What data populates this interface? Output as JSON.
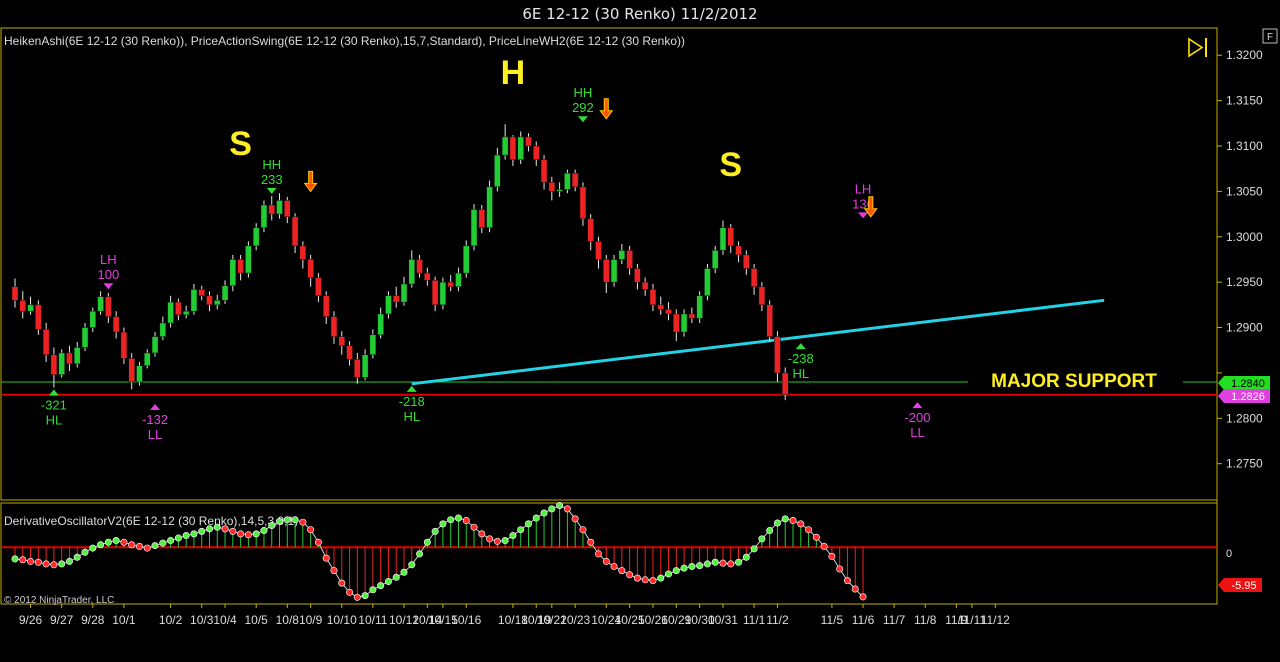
{
  "window": {
    "title": "6E 12-12 (30 Renko)  11/2/2012"
  },
  "price_panel": {
    "indicator_label": "HeikenAshi(6E 12-12 (30 Renko)), PriceActionSwing(6E 12-12 (30 Renko),15,7,Standard), PriceLineWH2(6E 12-12 (30 Renko))",
    "support_label": "MAJOR SUPPORT",
    "price_tag_green": "1.2840",
    "price_tag_magenta": "1.2826",
    "f_button": "F",
    "big_labels": [
      {
        "text": "S",
        "bar": 29
      },
      {
        "text": "H",
        "bar": 64
      },
      {
        "text": "S",
        "bar": 92
      }
    ]
  },
  "oscillator_panel": {
    "indicator_label": "DerivativeOscillatorV2(6E 12-12 (30 Renko),14,5,3,9,1)",
    "zero_label": "0",
    "value_tag": "-5.95",
    "copyright": "© 2012 NinjaTrader, LLC"
  },
  "colors": {
    "up": "#22cc33",
    "down": "#ee2222",
    "support_green": "#22cc22",
    "support_red": "#dd0000",
    "trendline": "#22d3e6",
    "label_yellow": "#ffee22",
    "swing_green": "#33dd33",
    "swing_magenta": "#e040e0",
    "axis_yellow": "#c8b400"
  },
  "chart_data": {
    "type": "candlestick",
    "title": "6E 12-12 (30 Renko)  11/2/2012",
    "ylim": [
      1.271,
      1.323
    ],
    "yticks": [
      1.32,
      1.315,
      1.31,
      1.305,
      1.3,
      1.295,
      1.29,
      1.285,
      1.28,
      1.275
    ],
    "ytick_labels": [
      "1.3200",
      "1.3150",
      "1.3100",
      "1.3050",
      "1.3000",
      "1.2950",
      "1.2900",
      "",
      "1.2800",
      "1.2750"
    ],
    "x_labels": [
      "9/26",
      "9/27",
      "9/28",
      "10/1",
      "10/2",
      "10/3",
      "10/4",
      "10/5",
      "10/8",
      "10/9",
      "10/10",
      "10/11",
      "10/12",
      "10/14",
      "10/15",
      "10/16",
      "10/18",
      "10/19",
      "10/22",
      "10/23",
      "10/24",
      "10/25",
      "10/26",
      "10/29",
      "10/30",
      "10/31",
      "11/1",
      "11/2",
      "11/5",
      "11/6",
      "11/7",
      "11/8",
      "11/9",
      "11/11",
      "11/12"
    ],
    "x_label_bars": [
      2,
      6,
      10,
      14,
      20,
      24,
      27,
      31,
      35,
      38,
      42,
      46,
      50,
      53,
      55,
      58,
      64,
      67,
      69,
      72,
      76,
      79,
      82,
      85,
      88,
      91,
      95,
      98,
      105,
      109,
      113,
      117,
      121,
      123,
      126
    ],
    "candles": [
      [
        1.2945,
        1.293,
        1.2954,
        1.2922
      ],
      [
        1.293,
        1.2918,
        1.294,
        1.291
      ],
      [
        1.2918,
        1.2925,
        1.2934,
        1.2914
      ],
      [
        1.2925,
        1.2898,
        1.293,
        1.2892
      ],
      [
        1.2898,
        1.287,
        1.2905,
        1.2862
      ],
      [
        1.287,
        1.2848,
        1.2878,
        1.2834
      ],
      [
        1.2848,
        1.2872,
        1.2876,
        1.2845
      ],
      [
        1.2872,
        1.286,
        1.288,
        1.2852
      ],
      [
        1.286,
        1.2878,
        1.2884,
        1.2856
      ],
      [
        1.2878,
        1.29,
        1.2905,
        1.2874
      ],
      [
        1.29,
        1.2918,
        1.2922,
        1.2895
      ],
      [
        1.2918,
        1.2934,
        1.294,
        1.2914
      ],
      [
        1.2934,
        1.2912,
        1.2938,
        1.2905
      ],
      [
        1.2912,
        1.2895,
        1.2918,
        1.2888
      ],
      [
        1.2895,
        1.2866,
        1.29,
        1.286
      ],
      [
        1.2866,
        1.284,
        1.2872,
        1.2832
      ],
      [
        1.284,
        1.2858,
        1.2862,
        1.2836
      ],
      [
        1.2858,
        1.2872,
        1.2876,
        1.2855
      ],
      [
        1.2872,
        1.289,
        1.2895,
        1.2868
      ],
      [
        1.289,
        1.2905,
        1.2912,
        1.2886
      ],
      [
        1.2905,
        1.2928,
        1.2935,
        1.29
      ],
      [
        1.2928,
        1.2914,
        1.2932,
        1.2908
      ],
      [
        1.2914,
        1.2918,
        1.2924,
        1.291
      ],
      [
        1.2918,
        1.2942,
        1.2948,
        1.2914
      ],
      [
        1.2942,
        1.2935,
        1.2946,
        1.293
      ],
      [
        1.2935,
        1.2925,
        1.294,
        1.2918
      ],
      [
        1.2925,
        1.293,
        1.2936,
        1.292
      ],
      [
        1.293,
        1.2946,
        1.2952,
        1.2926
      ],
      [
        1.2946,
        1.2975,
        1.298,
        1.294
      ],
      [
        1.2975,
        1.296,
        1.298,
        1.2952
      ],
      [
        1.296,
        1.299,
        1.2995,
        1.2955
      ],
      [
        1.299,
        1.301,
        1.3015,
        1.2985
      ],
      [
        1.301,
        1.3035,
        1.304,
        1.3005
      ],
      [
        1.3035,
        1.3025,
        1.3045,
        1.3018
      ],
      [
        1.3025,
        1.304,
        1.3048,
        1.302
      ],
      [
        1.304,
        1.3022,
        1.3044,
        1.3015
      ],
      [
        1.3022,
        1.299,
        1.3026,
        1.2982
      ],
      [
        1.299,
        1.2975,
        1.2995,
        1.2965
      ],
      [
        1.2975,
        1.2955,
        1.298,
        1.2945
      ],
      [
        1.2955,
        1.2935,
        1.296,
        1.2928
      ],
      [
        1.2935,
        1.2912,
        1.294,
        1.2904
      ],
      [
        1.2912,
        1.289,
        1.2918,
        1.2882
      ],
      [
        1.289,
        1.288,
        1.2896,
        1.287
      ],
      [
        1.288,
        1.2865,
        1.2885,
        1.2858
      ],
      [
        1.2865,
        1.2845,
        1.2872,
        1.2838
      ],
      [
        1.2845,
        1.287,
        1.2876,
        1.2842
      ],
      [
        1.287,
        1.2892,
        1.2898,
        1.2866
      ],
      [
        1.2892,
        1.2915,
        1.2922,
        1.2888
      ],
      [
        1.2915,
        1.2935,
        1.294,
        1.291
      ],
      [
        1.2935,
        1.2928,
        1.2945,
        1.2922
      ],
      [
        1.2928,
        1.2948,
        1.2956,
        1.2924
      ],
      [
        1.2948,
        1.2975,
        1.2985,
        1.2944
      ],
      [
        1.2975,
        1.296,
        1.298,
        1.2955
      ],
      [
        1.296,
        1.2952,
        1.2966,
        1.2946
      ],
      [
        1.2952,
        1.2925,
        1.2956,
        1.2918
      ],
      [
        1.2925,
        1.295,
        1.2955,
        1.292
      ],
      [
        1.295,
        1.2945,
        1.2958,
        1.294
      ],
      [
        1.2945,
        1.296,
        1.2966,
        1.294
      ],
      [
        1.296,
        1.299,
        1.2996,
        1.2955
      ],
      [
        1.299,
        1.303,
        1.3036,
        1.2985
      ],
      [
        1.303,
        1.301,
        1.3035,
        1.3004
      ],
      [
        1.301,
        1.3055,
        1.3062,
        1.3005
      ],
      [
        1.3055,
        1.309,
        1.3098,
        1.305
      ],
      [
        1.309,
        1.311,
        1.3124,
        1.3085
      ],
      [
        1.311,
        1.3085,
        1.3112,
        1.3078
      ],
      [
        1.3085,
        1.311,
        1.3116,
        1.308
      ],
      [
        1.311,
        1.31,
        1.3114,
        1.3094
      ],
      [
        1.31,
        1.3085,
        1.3105,
        1.3078
      ],
      [
        1.3085,
        1.306,
        1.309,
        1.3052
      ],
      [
        1.306,
        1.305,
        1.3066,
        1.304
      ],
      [
        1.305,
        1.3052,
        1.306,
        1.3044
      ],
      [
        1.3052,
        1.307,
        1.3074,
        1.3048
      ],
      [
        1.307,
        1.3055,
        1.3074,
        1.305
      ],
      [
        1.3055,
        1.302,
        1.306,
        1.3012
      ],
      [
        1.302,
        1.2995,
        1.3025,
        1.2985
      ],
      [
        1.2995,
        1.2975,
        1.3,
        1.2965
      ],
      [
        1.2975,
        1.295,
        1.298,
        1.2938
      ],
      [
        1.295,
        1.2975,
        1.298,
        1.2945
      ],
      [
        1.2975,
        1.2985,
        1.2992,
        1.297
      ],
      [
        1.2985,
        1.2965,
        1.299,
        1.2958
      ],
      [
        1.2965,
        1.295,
        1.297,
        1.2942
      ],
      [
        1.295,
        1.2942,
        1.2955,
        1.2935
      ],
      [
        1.2942,
        1.2925,
        1.2948,
        1.2918
      ],
      [
        1.2925,
        1.292,
        1.2934,
        1.2914
      ],
      [
        1.292,
        1.2915,
        1.2928,
        1.2908
      ],
      [
        1.2915,
        1.2895,
        1.292,
        1.2885
      ],
      [
        1.2895,
        1.2915,
        1.292,
        1.289
      ],
      [
        1.2915,
        1.291,
        1.2922,
        1.2905
      ],
      [
        1.291,
        1.2935,
        1.294,
        1.2905
      ],
      [
        1.2935,
        1.2965,
        1.297,
        1.293
      ],
      [
        1.2965,
        1.2985,
        1.299,
        1.296
      ],
      [
        1.2985,
        1.301,
        1.3018,
        1.298
      ],
      [
        1.301,
        1.299,
        1.3014,
        1.2982
      ],
      [
        1.299,
        1.298,
        1.2995,
        1.2972
      ],
      [
        1.298,
        1.2965,
        1.2985,
        1.2958
      ],
      [
        1.2965,
        1.2945,
        1.297,
        1.2936
      ],
      [
        1.2945,
        1.2925,
        1.295,
        1.2918
      ],
      [
        1.2925,
        1.289,
        1.293,
        1.2884
      ],
      [
        1.289,
        1.285,
        1.2896,
        1.284
      ],
      [
        1.285,
        1.2826,
        1.2856,
        1.282
      ]
    ],
    "swing_points": [
      {
        "bar": 5,
        "type": "HL",
        "value": "-321",
        "price": 1.2834,
        "pos": "below"
      },
      {
        "bar": 12,
        "type": "LH",
        "value": "100",
        "price": 1.294,
        "pos": "above"
      },
      {
        "bar": 18,
        "type": "LL",
        "value": "-132",
        "price": 1.2818,
        "pos": "below"
      },
      {
        "bar": 33,
        "type": "HH",
        "value": "233",
        "price": 1.3045,
        "pos": "above"
      },
      {
        "bar": 51,
        "type": "HL",
        "value": "-218",
        "price": 1.2838,
        "pos": "below"
      },
      {
        "bar": 73,
        "type": "HH",
        "value": "292",
        "price": 1.3124,
        "pos": "above"
      },
      {
        "bar": 101,
        "type": "HL",
        "value": "-238",
        "price": 1.2885,
        "pos": "below"
      },
      {
        "bar": 109,
        "type": "LH",
        "value": "136",
        "price": 1.3018,
        "pos": "above"
      },
      {
        "bar": 116,
        "type": "LL",
        "value": "-200",
        "price": 1.282,
        "pos": "below"
      }
    ],
    "sell_arrows": [
      {
        "bar": 38,
        "price": 1.305
      },
      {
        "bar": 76,
        "price": 1.313
      },
      {
        "bar": 110,
        "price": 1.3022
      }
    ],
    "support_lines": [
      {
        "price": 1.284,
        "color": "green"
      },
      {
        "price": 1.2826,
        "color": "red"
      }
    ],
    "trendline": {
      "from": {
        "bar": 51,
        "price": 1.2838
      },
      "to": {
        "bar": 140,
        "price": 1.293
      }
    },
    "oscillator": {
      "ylim": [
        -6.8,
        5.3
      ],
      "zero": 0,
      "values": [
        -1.4,
        -1.5,
        -1.7,
        -1.8,
        -2.0,
        -2.1,
        -2.0,
        -1.7,
        -1.2,
        -0.6,
        -0.1,
        0.3,
        0.6,
        0.8,
        0.6,
        0.3,
        0.1,
        -0.1,
        0.2,
        0.5,
        0.8,
        1.1,
        1.4,
        1.6,
        1.9,
        2.2,
        2.4,
        2.2,
        1.9,
        1.6,
        1.5,
        1.6,
        2.0,
        2.6,
        3.1,
        3.3,
        3.3,
        3.0,
        2.1,
        0.6,
        -1.3,
        -2.8,
        -4.3,
        -5.4,
        -6.0,
        -5.8,
        -5.1,
        -4.6,
        -4.1,
        -3.6,
        -3.0,
        -2.1,
        -0.8,
        0.6,
        1.9,
        2.8,
        3.3,
        3.5,
        3.2,
        2.4,
        1.6,
        1.0,
        0.7,
        0.8,
        1.4,
        2.1,
        2.8,
        3.5,
        4.1,
        4.6,
        5.0,
        4.6,
        3.4,
        2.1,
        0.6,
        -0.8,
        -1.7,
        -2.3,
        -2.8,
        -3.3,
        -3.7,
        -3.9,
        -4.0,
        -3.7,
        -3.2,
        -2.8,
        -2.5,
        -2.3,
        -2.2,
        -2.0,
        -1.8,
        -1.9,
        -2.0,
        -1.8,
        -1.2,
        -0.2,
        1.0,
        2.0,
        2.9,
        3.4,
        3.2,
        2.8,
        2.1,
        1.2,
        0.1,
        -1.1,
        -2.6,
        -4.0,
        -5.0,
        -5.95
      ]
    }
  }
}
